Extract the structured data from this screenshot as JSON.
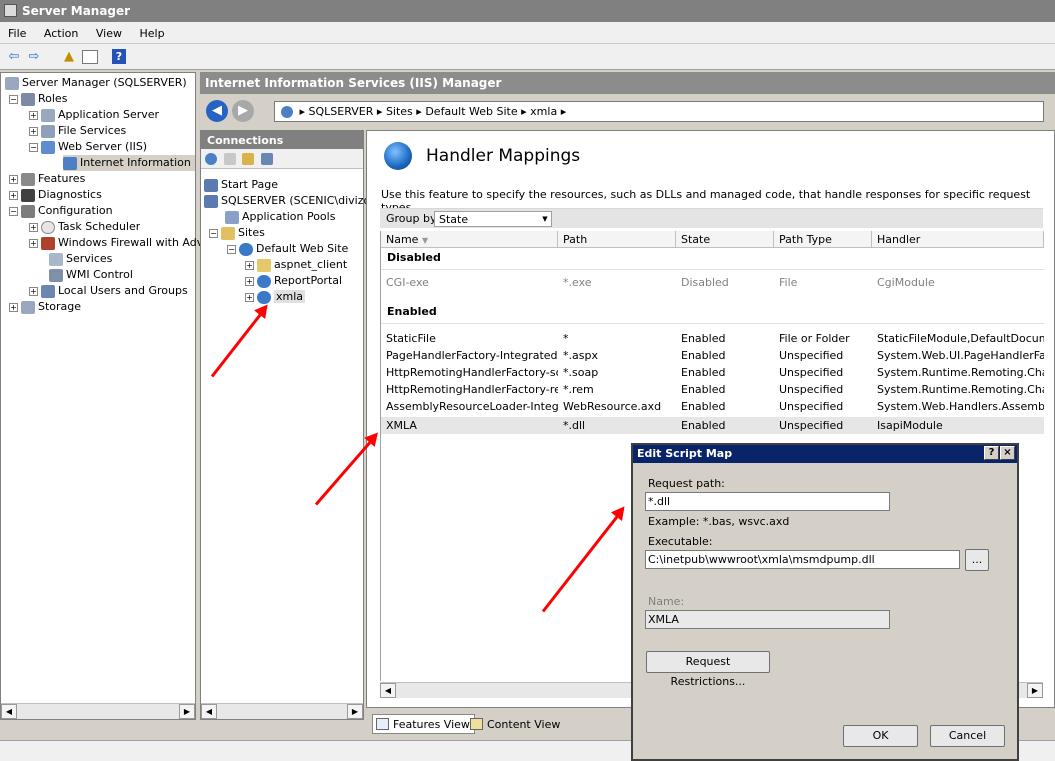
{
  "window": {
    "title": "Server Manager"
  },
  "menu": {
    "items": [
      "File",
      "Action",
      "View",
      "Help"
    ]
  },
  "left_tree": {
    "items": [
      {
        "label": "Server Manager (SQLSERVER)",
        "expander": ""
      },
      {
        "label": "Roles",
        "expander": "−"
      },
      {
        "label": "Application Server",
        "expander": "+"
      },
      {
        "label": "File Services",
        "expander": "+"
      },
      {
        "label": "Web Server (IIS)",
        "expander": "−"
      },
      {
        "label": "Internet Information Se",
        "expander": ""
      },
      {
        "label": "Features",
        "expander": "+"
      },
      {
        "label": "Diagnostics",
        "expander": "+"
      },
      {
        "label": "Configuration",
        "expander": "−"
      },
      {
        "label": "Task Scheduler",
        "expander": "+"
      },
      {
        "label": "Windows Firewall with Adva",
        "expander": "+"
      },
      {
        "label": "Services",
        "expander": ""
      },
      {
        "label": "WMI Control",
        "expander": ""
      },
      {
        "label": "Local Users and Groups",
        "expander": "+"
      },
      {
        "label": "Storage",
        "expander": "+"
      }
    ]
  },
  "iis": {
    "header": "Internet Information Services (IIS) Manager",
    "breadcrumb": [
      "SQLSERVER",
      "Sites",
      "Default Web Site",
      "xmla"
    ]
  },
  "connections": {
    "title": "Connections",
    "items": [
      {
        "label": "Start Page",
        "expander": ""
      },
      {
        "label": "SQLSERVER (SCENIC\\divizo)",
        "expander": "−"
      },
      {
        "label": "Application Pools",
        "expander": ""
      },
      {
        "label": "Sites",
        "expander": "−"
      },
      {
        "label": "Default Web Site",
        "expander": "−"
      },
      {
        "label": "aspnet_client",
        "expander": "+"
      },
      {
        "label": "ReportPortal",
        "expander": "+"
      },
      {
        "label": "xmla",
        "expander": "+"
      }
    ]
  },
  "feature": {
    "title": "Handler Mappings",
    "description": "Use this feature to specify the resources, such as DLLs and managed code, that handle responses for specific request types.",
    "group_by_label": "Group by:",
    "group_by_value": "State",
    "columns": [
      "Name",
      "Path",
      "State",
      "Path Type",
      "Handler"
    ],
    "groups": [
      {
        "label": "Disabled",
        "rows": [
          {
            "name": "CGI-exe",
            "path": "*.exe",
            "state": "Disabled",
            "path_type": "File",
            "handler": "CgiModule"
          }
        ]
      },
      {
        "label": "Enabled",
        "rows": [
          {
            "name": "StaticFile",
            "path": "*",
            "state": "Enabled",
            "path_type": "File or Folder",
            "handler": "StaticFileModule,DefaultDocume…"
          },
          {
            "name": "PageHandlerFactory-Integrated",
            "path": "*.aspx",
            "state": "Enabled",
            "path_type": "Unspecified",
            "handler": "System.Web.UI.PageHandlerFa…"
          },
          {
            "name": "HttpRemotingHandlerFactory-so…",
            "path": "*.soap",
            "state": "Enabled",
            "path_type": "Unspecified",
            "handler": "System.Runtime.Remoting.Chan…"
          },
          {
            "name": "HttpRemotingHandlerFactory-re…",
            "path": "*.rem",
            "state": "Enabled",
            "path_type": "Unspecified",
            "handler": "System.Runtime.Remoting.Chan…"
          },
          {
            "name": "AssemblyResourceLoader-Integr…",
            "path": "WebResource.axd",
            "state": "Enabled",
            "path_type": "Unspecified",
            "handler": "System.Web.Handlers.Assembly…"
          },
          {
            "name": "XMLA",
            "path": "*.dll",
            "state": "Enabled",
            "path_type": "Unspecified",
            "handler": "IsapiModule"
          }
        ]
      }
    ]
  },
  "bottom_tabs": {
    "features_view": "Features View",
    "content_view": "Content View"
  },
  "dialog": {
    "title": "Edit Script Map",
    "help_glyph": "?",
    "close_glyph": "×",
    "request_path_label": "Request path:",
    "request_path_value": "*.dll",
    "example_text": "Example: *.bas, wsvc.axd",
    "executable_label": "Executable:",
    "executable_value": "C:\\inetpub\\wwwroot\\xmla\\msmdpump.dll",
    "browse_label": "...",
    "name_label": "Name:",
    "name_value": "XMLA",
    "request_restrictions_label": "Request Restrictions...",
    "ok_label": "OK",
    "cancel_label": "Cancel"
  }
}
